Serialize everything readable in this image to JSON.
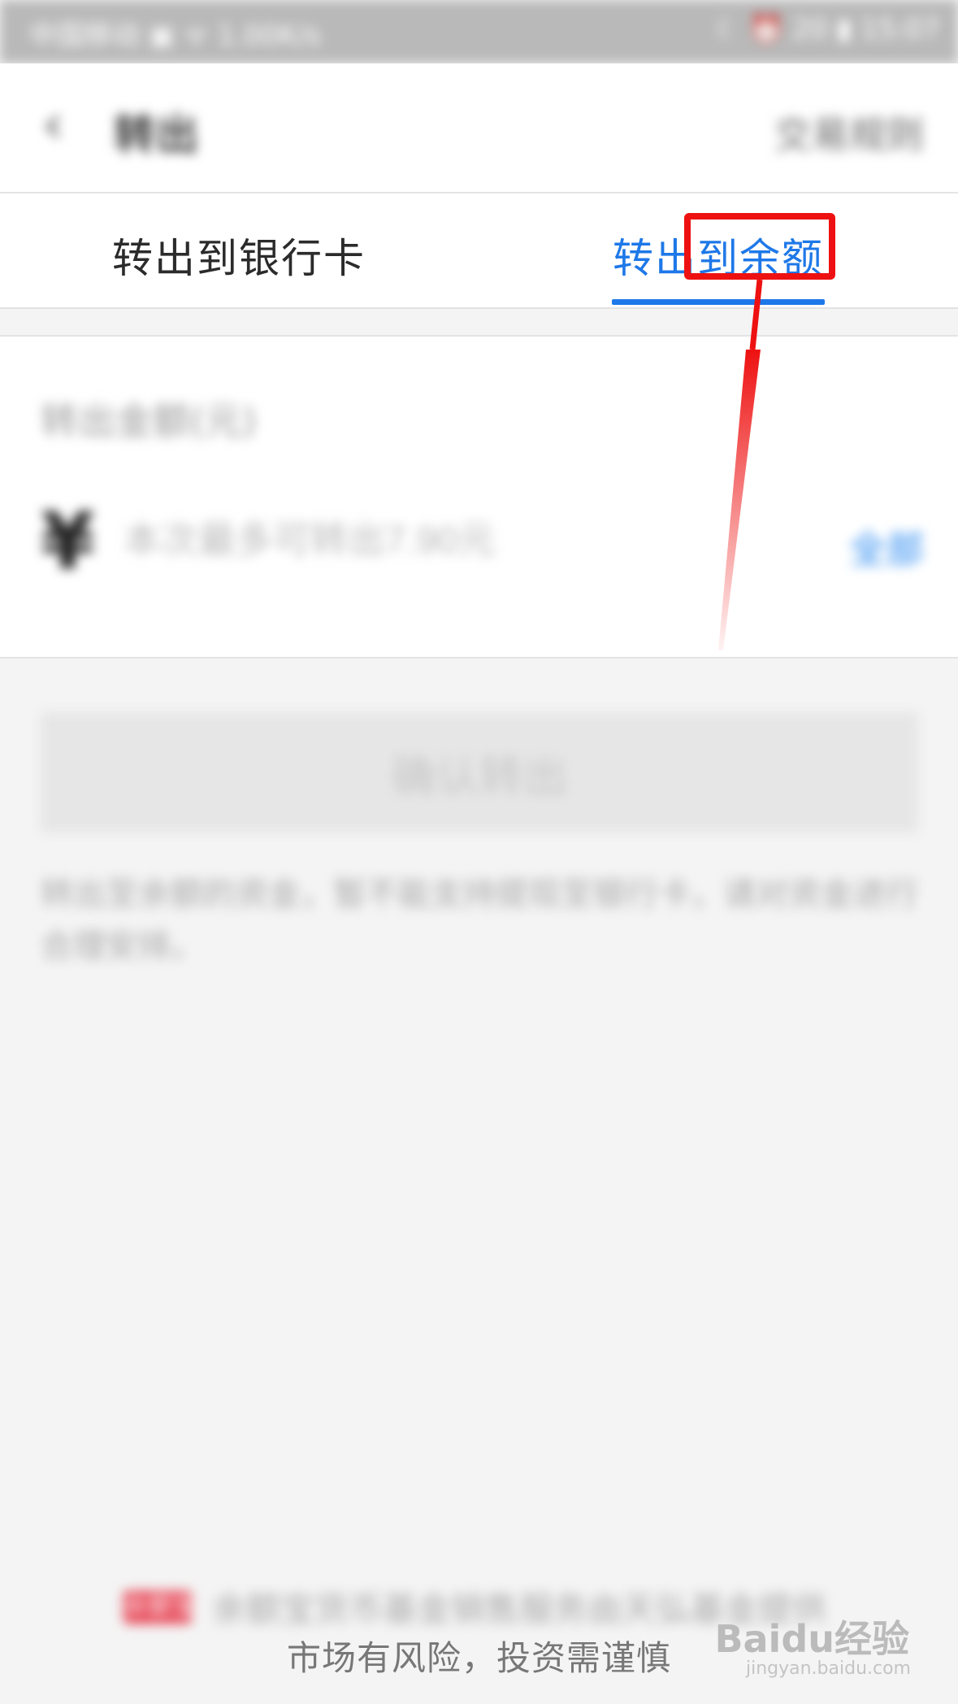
{
  "status_bar": {
    "left_text": "中国移动 ▣ ᯤ 1.00K/s",
    "right_text": "☾ ⏰ 20 ▮ 15:07"
  },
  "nav": {
    "back_icon": "chevron-left-icon",
    "title": "转出",
    "action": "交易规则"
  },
  "tabs": [
    {
      "label": "转出到银行卡",
      "active": false
    },
    {
      "label": "转出到余额",
      "active": true
    }
  ],
  "active_color": "#1e78e8",
  "annotation_color": "#ee1111",
  "form": {
    "amount_label": "转出金额(元)",
    "currency_symbol": "¥",
    "amount_placeholder": "本次最多可转出7.90元",
    "all_link": "全部"
  },
  "confirm_button": "确认转出",
  "note": "转出至余额的资金，暂不能支持提现至银行卡，请对资金进行合理安排。",
  "footer": {
    "badge": "余额宝",
    "line1": "余额宝货币基金销售服务由天弘基金提供",
    "line2": "市场有风险，投资需谨慎"
  },
  "watermark": {
    "text": "Baidu经验",
    "url_text": "jingyan.baidu.com"
  }
}
